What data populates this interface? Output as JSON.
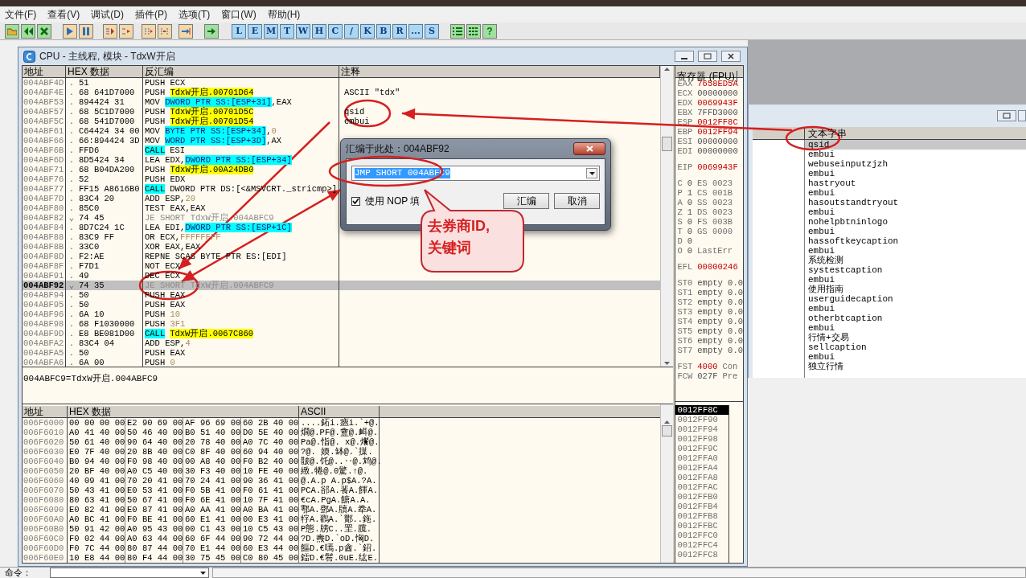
{
  "menu": [
    "文件(F)",
    "查看(V)",
    "调试(D)",
    "插件(P)",
    "选项(T)",
    "窗口(W)",
    "帮助(H)"
  ],
  "toolbar": {
    "letter_buttons": [
      "L",
      "E",
      "M",
      "T",
      "W",
      "H",
      "C",
      "/",
      "K",
      "B",
      "R",
      "...",
      "S"
    ],
    "help_button": "?"
  },
  "cpu_window": {
    "title": "CPU - 主线程, 模块 - TdxW开启",
    "disassembly": {
      "columns": [
        "地址",
        "HEX 数据",
        "反汇编",
        "注释"
      ],
      "rows": [
        {
          "address": "004ABF4D",
          "mark": ".",
          "hex": "51",
          "code": [
            {
              "text": "PUSH ECX",
              "kind": "plain"
            }
          ],
          "selected": false
        },
        {
          "address": "004ABF4E",
          "mark": ".",
          "hex": "68 641D7000",
          "code": [
            {
              "text": "PUSH ",
              "kind": "plain"
            },
            {
              "text": "TdxW开启.00701D64",
              "kind": "label"
            }
          ],
          "comment": "ASCII \"tdx\"",
          "selected": false
        },
        {
          "address": "004ABF53",
          "mark": ".",
          "hex": "894424 31",
          "code": [
            {
              "text": "MOV ",
              "kind": "plain"
            },
            {
              "text": "DWORD PTR SS:[ESP+31]",
              "kind": "mem"
            },
            {
              "text": ",EAX",
              "kind": "plain"
            }
          ],
          "selected": false
        },
        {
          "address": "004ABF57",
          "mark": ".",
          "hex": "68 5C1D7000",
          "code": [
            {
              "text": "PUSH ",
              "kind": "plain"
            },
            {
              "text": "TdxW开启.00701D5C",
              "kind": "label"
            }
          ],
          "comment": "qsid",
          "selected": false
        },
        {
          "address": "004ABF5C",
          "mark": ".",
          "hex": "68 541D7000",
          "code": [
            {
              "text": "PUSH ",
              "kind": "plain"
            },
            {
              "text": "TdxW开启.00701D54",
              "kind": "label"
            }
          ],
          "comment": "embui",
          "selected": false
        },
        {
          "address": "004ABF61",
          "mark": ".",
          "hex": "C64424 34 00",
          "code": [
            {
              "text": "MOV ",
              "kind": "plain"
            },
            {
              "text": "BYTE PTR SS:[ESP+34]",
              "kind": "mem"
            },
            {
              "text": ",",
              "kind": "plain"
            },
            {
              "text": "0",
              "kind": "const"
            }
          ],
          "selected": false
        },
        {
          "address": "004ABF66",
          "mark": ".",
          "hex": "66:894424 3D",
          "code": [
            {
              "text": "MOV ",
              "kind": "plain"
            },
            {
              "text": "WORD PTR SS:[ESP+3D]",
              "kind": "mem"
            },
            {
              "text": ",AX",
              "kind": "plain"
            }
          ],
          "selected": false
        },
        {
          "address": "004ABF6B",
          "mark": ".",
          "hex": "FFD6",
          "code": [
            {
              "text": "CALL",
              "kind": "call"
            },
            {
              "text": "ESI",
              "kind": "plain"
            }
          ],
          "selected": false
        },
        {
          "address": "004ABF6D",
          "mark": ".",
          "hex": "8D5424 34",
          "code": [
            {
              "text": "LEA EDX,",
              "kind": "plain"
            },
            {
              "text": "DWORD PTR SS:[ESP+34]",
              "kind": "mem"
            }
          ],
          "selected": false
        },
        {
          "address": "004ABF71",
          "mark": ".",
          "hex": "68 B04DA200",
          "code": [
            {
              "text": "PUSH ",
              "kind": "plain"
            },
            {
              "text": "TdxW开启.00A24DB0",
              "kind": "label"
            }
          ],
          "selected": false
        },
        {
          "address": "004ABF76",
          "mark": ".",
          "hex": "52",
          "code": [
            {
              "text": "PUSH EDX",
              "kind": "plain"
            }
          ],
          "selected": false
        },
        {
          "address": "004ABF77",
          "mark": ".",
          "hex": "FF15 A8616B0",
          "code": [
            {
              "text": "CALL",
              "kind": "call"
            },
            {
              "text": "DWORD PTR DS:[<&MSVCRT._stricmp>]",
              "kind": "plain"
            }
          ],
          "selected": false
        },
        {
          "address": "004ABF7D",
          "mark": ".",
          "hex": "83C4 20",
          "code": [
            {
              "text": "ADD ESP,",
              "kind": "plain"
            },
            {
              "text": "20",
              "kind": "const"
            }
          ],
          "selected": false
        },
        {
          "address": "004ABF80",
          "mark": ".",
          "hex": "85C0",
          "code": [
            {
              "text": "TEST EAX,EAX",
              "kind": "plain"
            }
          ],
          "selected": false
        },
        {
          "address": "004ABF82",
          "mark": "⌄",
          "hex": "74 45",
          "code": [
            {
              "text": "JE SHORT TdxW开启.004ABFC9",
              "kind": "jump"
            }
          ],
          "selected": false
        },
        {
          "address": "004ABF84",
          "mark": ".",
          "hex": "8D7C24 1C",
          "code": [
            {
              "text": "LEA EDI,",
              "kind": "plain"
            },
            {
              "text": "DWORD PTR SS:[ESP+1C]",
              "kind": "mem"
            }
          ],
          "selected": false
        },
        {
          "address": "004ABF88",
          "mark": ".",
          "hex": "83C9 FF",
          "code": [
            {
              "text": "OR ECX,",
              "kind": "plain"
            },
            {
              "text": "FFFFFFFF",
              "kind": "const"
            }
          ],
          "selected": false
        },
        {
          "address": "004ABF8B",
          "mark": ".",
          "hex": "33C0",
          "code": [
            {
              "text": "XOR EAX,EAX",
              "kind": "plain"
            }
          ],
          "selected": false
        },
        {
          "address": "004ABF8D",
          "mark": ".",
          "hex": "F2:AE",
          "code": [
            {
              "text": "REPNE SCAS BYTE PTR ES:[EDI]",
              "kind": "plain"
            }
          ],
          "selected": false
        },
        {
          "address": "004ABF8F",
          "mark": ".",
          "hex": "F7D1",
          "code": [
            {
              "text": "NOT ECX",
              "kind": "plain"
            }
          ],
          "selected": false
        },
        {
          "address": "004ABF91",
          "mark": ".",
          "hex": "49",
          "code": [
            {
              "text": "DEC ECX",
              "kind": "plain"
            }
          ],
          "selected": false
        },
        {
          "address": "004ABF92",
          "mark": "⌄",
          "hex": "74 35",
          "code": [
            {
              "text": "JE SHORT TdxW开启.004ABFC9",
              "kind": "jump"
            }
          ],
          "selected": true
        },
        {
          "address": "004ABF94",
          "mark": ".",
          "hex": "50",
          "code": [
            {
              "text": "PUSH EAX",
              "kind": "plain"
            }
          ],
          "selected": false
        },
        {
          "address": "004ABF95",
          "mark": ".",
          "hex": "50",
          "code": [
            {
              "text": "PUSH EAX",
              "kind": "plain"
            }
          ],
          "selected": false
        },
        {
          "address": "004ABF96",
          "mark": ".",
          "hex": "6A 10",
          "code": [
            {
              "text": "PUSH ",
              "kind": "plain"
            },
            {
              "text": "10",
              "kind": "const"
            }
          ],
          "selected": false
        },
        {
          "address": "004ABF98",
          "mark": ".",
          "hex": "68 F1030000",
          "code": [
            {
              "text": "PUSH ",
              "kind": "plain"
            },
            {
              "text": "3F1",
              "kind": "const"
            }
          ],
          "selected": false
        },
        {
          "address": "004ABF9D",
          "mark": ".",
          "hex": "E8 BE081D00",
          "code": [
            {
              "text": "CALL",
              "kind": "call"
            },
            {
              "text": "TdxW开启.0067C860",
              "kind": "label"
            }
          ],
          "selected": false
        },
        {
          "address": "004ABFA2",
          "mark": ".",
          "hex": "83C4 04",
          "code": [
            {
              "text": "ADD ESP,",
              "kind": "plain"
            },
            {
              "text": "4",
              "kind": "const"
            }
          ],
          "selected": false
        },
        {
          "address": "004ABFA5",
          "mark": ".",
          "hex": "50",
          "code": [
            {
              "text": "PUSH EAX",
              "kind": "plain"
            }
          ],
          "selected": false
        },
        {
          "address": "004ABFA6",
          "mark": ".",
          "hex": "6A 00",
          "code": [
            {
              "text": "PUSH ",
              "kind": "plain"
            },
            {
              "text": "0",
              "kind": "const"
            }
          ],
          "selected": false
        }
      ]
    },
    "info_line": "004ABFC9=TdxW开启.004ABFC9",
    "registers": {
      "title": "寄存器 (FPU)",
      "groups": [
        [
          {
            "name": "EAX",
            "value": "7658ED5A",
            "changed": true
          },
          {
            "name": "ECX",
            "value": "00000000",
            "changed": false
          },
          {
            "name": "EDX",
            "value": "0069943F",
            "changed": true
          },
          {
            "name": "EBX",
            "value": "7FFD3000",
            "changed": false
          },
          {
            "name": "ESP",
            "value": "0012FF8C",
            "changed": true
          },
          {
            "name": "EBP",
            "value": "0012FF94",
            "changed": true
          },
          {
            "name": "ESI",
            "value": "00000000",
            "changed": false
          },
          {
            "name": "EDI",
            "value": "00000000",
            "changed": false
          }
        ],
        [
          {
            "name": "EIP",
            "value": "0069943F",
            "changed": true
          }
        ],
        [
          {
            "name": "C",
            "value": "0",
            "extra": "ES 0023",
            "changed": false
          },
          {
            "name": "P",
            "value": "1",
            "extra": "CS 001B",
            "changed": false
          },
          {
            "name": "A",
            "value": "0",
            "extra": "SS 0023",
            "changed": false
          },
          {
            "name": "Z",
            "value": "1",
            "extra": "DS 0023",
            "changed": false
          },
          {
            "name": "S",
            "value": "0",
            "extra": "FS 003B",
            "changed": false
          },
          {
            "name": "T",
            "value": "0",
            "extra": "GS 0000",
            "changed": false
          },
          {
            "name": "D",
            "value": "0",
            "changed": false
          },
          {
            "name": "O",
            "value": "0",
            "extra": "LastErr",
            "changed": false
          }
        ],
        [
          {
            "name": "EFL",
            "value": "00000246",
            "changed": true
          }
        ],
        [
          {
            "name": "ST0",
            "value": "empty 0.0",
            "changed": false
          },
          {
            "name": "ST1",
            "value": "empty 0.0",
            "changed": false
          },
          {
            "name": "ST2",
            "value": "empty 0.0",
            "changed": false
          },
          {
            "name": "ST3",
            "value": "empty 0.0",
            "changed": false
          },
          {
            "name": "ST4",
            "value": "empty 0.0",
            "changed": false
          },
          {
            "name": "ST5",
            "value": "empty 0.0",
            "changed": false
          },
          {
            "name": "ST6",
            "value": "empty 0.0",
            "changed": false
          },
          {
            "name": "ST7",
            "value": "empty 0.0",
            "changed": false
          }
        ],
        [
          {
            "name": "FST",
            "value": "4000",
            "extra": "Con",
            "changed": true
          },
          {
            "name": "FCW",
            "value": "027F",
            "extra": "Pre",
            "changed": false
          }
        ]
      ]
    },
    "dump": {
      "columns": [
        "地址",
        "HEX 数据",
        "ASCII"
      ],
      "rows": [
        {
          "address": "006F6000",
          "hex": [
            "00 00 00 00",
            "E2 90 69 00",
            "AF 96 69 00",
            "60 2B 40 00"
          ],
          "ascii": "....鉐i.瘱i.`+@."
        },
        {
          "address": "006F6010",
          "hex": [
            "A0 41 40 00",
            "50 46 40 00",
            "B0 51 40 00",
            "D0 5E 40 00"
          ],
          "ascii": "燗@.PF@.盦@.衈@."
        },
        {
          "address": "006F6020",
          "hex": [
            "50 61 40 00",
            "90 64 40 00",
            "20 78 40 00",
            "A0 7C 40 00"
          ],
          "ascii": "Pa@.恉@. x@.爘@."
        },
        {
          "address": "006F6030",
          "hex": [
            "E0 7F 40 00",
            "20 8B 40 00",
            "C0 8F 40 00",
            "60 94 40 00"
          ],
          "ascii": "?@. 媆.缽@.`擛."
        },
        {
          "address": "006F6040",
          "hex": [
            "B0 94 40 00",
            "F0 98 40 00",
            "00 A8 40 00",
            "F0 B2 40 00"
          ],
          "ascii": "皵@.饦@..‥@.鸩@."
        },
        {
          "address": "006F6050",
          "hex": [
            "20 BF 40 00",
            "A0 C5 40 00",
            "30 F3 40 00",
            "10 FE 40 00"
          ],
          "ascii": " 緻.犈@.0驚.↑@."
        },
        {
          "address": "006F6060",
          "hex": [
            "40 09 41 00",
            "70 20 41 00",
            "70 24 41 00",
            "90 36 41 00"
          ],
          "ascii": "@.A.p A.p$A.?A."
        },
        {
          "address": "006F6070",
          "hex": [
            "50 43 41 00",
            "E0 53 41 00",
            "F0 5B 41 00",
            "F0 61 41 00"
          ],
          "ascii": "PCA.郤A.餥A.餫A."
        },
        {
          "address": "006F6080",
          "hex": [
            "80 63 41 00",
            "50 67 41 00",
            "F0 6E 41 00",
            "10 7F 41 00"
          ],
          "ascii": "€cA.PgA.餹A.A."
        },
        {
          "address": "006F6090",
          "hex": [
            "E0 82 41 00",
            "E0 87 41 00",
            "A0 AA 41 00",
            "A0 BA 41 00"
          ],
          "ascii": "鄠A.鄧A.牘A.牶A."
        },
        {
          "address": "006F60A0",
          "hex": [
            "A0 BC 41 00",
            "F0 BE 41 00",
            "60 E1 41 00",
            "00 E3 41 00"
          ],
          "ascii": "牸A.鸐A.`酇..鉇."
        },
        {
          "address": "006F60B0",
          "hex": [
            "50 91 42 00",
            "A0 95 43 00",
            "00 C1 43 00",
            "10 C5 43 00"
          ],
          "ascii": "P態.牓C..罜.臗."
        },
        {
          "address": "006F60C0",
          "hex": [
            "F0 02 44 00",
            "A0 63 44 00",
            "60 6F 44 00",
            "90 72 44 00"
          ],
          "ascii": "?D.燾D.`oD.恟D."
        },
        {
          "address": "006F60D0",
          "hex": [
            "F0 7C 44 00",
            "80 87 44 00",
            "70 E1 44 00",
            "60 E3 44 00"
          ],
          "ascii": "饇D.€嘕.p酓.`鉊."
        },
        {
          "address": "006F60E0",
          "hex": [
            "10 E8 44 00",
            "80 F4 44 00",
            "30 75 45 00",
            "C0 80 45 00"
          ],
          "ascii": "鐳D.€鬌.0uE.纮E."
        }
      ]
    },
    "stack": {
      "rows": [
        {
          "address": "0012FF8C",
          "selected": true
        },
        {
          "address": "0012FF90",
          "selected": false
        },
        {
          "address": "0012FF94",
          "selected": false
        },
        {
          "address": "0012FF98",
          "selected": false
        },
        {
          "address": "0012FF9C",
          "selected": false
        },
        {
          "address": "0012FFA0",
          "selected": false
        },
        {
          "address": "0012FFA4",
          "selected": false
        },
        {
          "address": "0012FFA8",
          "selected": false
        },
        {
          "address": "0012FFAC",
          "selected": false
        },
        {
          "address": "0012FFB0",
          "selected": false
        },
        {
          "address": "0012FFB4",
          "selected": false
        },
        {
          "address": "0012FFB8",
          "selected": false
        },
        {
          "address": "0012FFBC",
          "selected": false
        },
        {
          "address": "0012FFC0",
          "selected": false
        },
        {
          "address": "0012FFC4",
          "selected": false
        },
        {
          "address": "0012FFC8",
          "selected": false
        }
      ]
    }
  },
  "strings_window": {
    "column": "文本字串",
    "rows": [
      {
        "text": "qsid",
        "selected": true
      },
      {
        "text": "embui",
        "selected": false
      },
      {
        "text": "webuseinputzjzh",
        "selected": false
      },
      {
        "text": "embui",
        "selected": false
      },
      {
        "text": "hastryout",
        "selected": false
      },
      {
        "text": "embui",
        "selected": false
      },
      {
        "text": "hasoutstandtryout",
        "selected": false
      },
      {
        "text": "embui",
        "selected": false
      },
      {
        "text": "nohelpbtninlogo",
        "selected": false
      },
      {
        "text": "embui",
        "selected": false
      },
      {
        "text": "hassoftkeycaption",
        "selected": false
      },
      {
        "text": "embui",
        "selected": false
      },
      {
        "text": "系统检测",
        "selected": false
      },
      {
        "text": "systestcaption",
        "selected": false
      },
      {
        "text": "embui",
        "selected": false
      },
      {
        "text": "使用指南",
        "selected": false
      },
      {
        "text": "userguidecaption",
        "selected": false
      },
      {
        "text": "embui",
        "selected": false
      },
      {
        "text": "otherbtcaption",
        "selected": false
      },
      {
        "text": "embui",
        "selected": false
      },
      {
        "text": "行情+交易",
        "selected": false
      },
      {
        "text": "sellcaption",
        "selected": false
      },
      {
        "text": "embui",
        "selected": false
      },
      {
        "text": "独立行情",
        "selected": false
      }
    ]
  },
  "dialog": {
    "title": "汇编于此处：004ABF92",
    "instruction": "JMP SHORT 004ABFC9",
    "nop_fill": {
      "label": "使用 NOP 填",
      "checked": true
    },
    "buttons": [
      "汇编",
      "取消"
    ]
  },
  "callout": {
    "lines": [
      "去券商ID,",
      "关键词"
    ]
  },
  "command_bar": {
    "label": "命令："
  }
}
